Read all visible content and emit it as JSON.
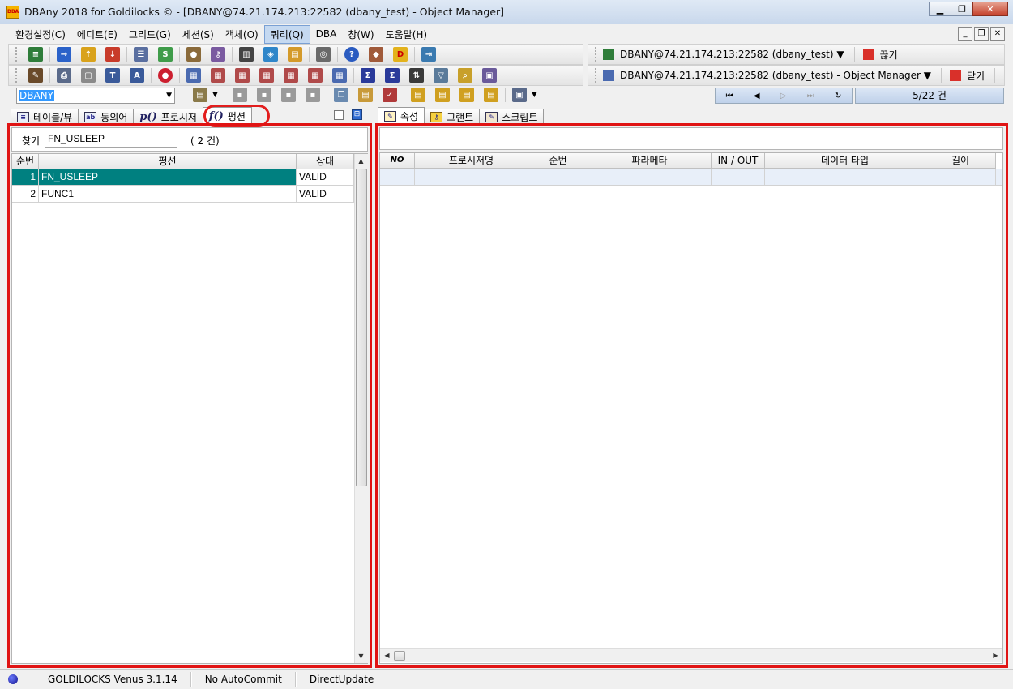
{
  "window": {
    "title": "DBAny 2018 for Goldilocks © - [DBANY@74.21.174.213:22582 (dbany_test) - Object Manager]",
    "app_icon_text": "DBA"
  },
  "menu": [
    "환경설정(C)",
    "에디트(E)",
    "그리드(G)",
    "세션(S)",
    "객체(O)",
    "쿼리(Q)",
    "DBA",
    "창(W)",
    "도움말(H)"
  ],
  "menu_active_index": 5,
  "toolbar": {
    "connection_label": "DBANY@74.21.174.213:22582 (dbany_test) ▼",
    "disconnect_label": "끊기",
    "window_label": "DBANY@74.21.174.213:22582 (dbany_test) - Object Manager ▼",
    "close_label": "닫기",
    "schema_combo": "DBANY",
    "record_count": "5/22 건"
  },
  "left_tabs": [
    "테이블/뷰",
    "동의어",
    "프로시저",
    "펑션"
  ],
  "left_tabs_active": 3,
  "right_tabs": [
    "속성",
    "그랜트",
    "스크립트"
  ],
  "search": {
    "label": "찾기",
    "value": "FN_USLEEP",
    "count": "( 2 건)"
  },
  "function_grid": {
    "headers": [
      "순번",
      "펑션",
      "상태"
    ],
    "rows": [
      {
        "no": "1",
        "name": "FN_USLEEP",
        "status": "VALID"
      },
      {
        "no": "2",
        "name": "FUNC1",
        "status": "VALID"
      }
    ]
  },
  "param_grid": {
    "headers": [
      "NO",
      "프로시저명",
      "순번",
      "파라메타",
      "IN / OUT",
      "데이터 타입",
      "길이"
    ]
  },
  "status": {
    "version": "GOLDILOCKS Venus 3.1.14",
    "commit": "No AutoCommit",
    "update": "DirectUpdate"
  }
}
